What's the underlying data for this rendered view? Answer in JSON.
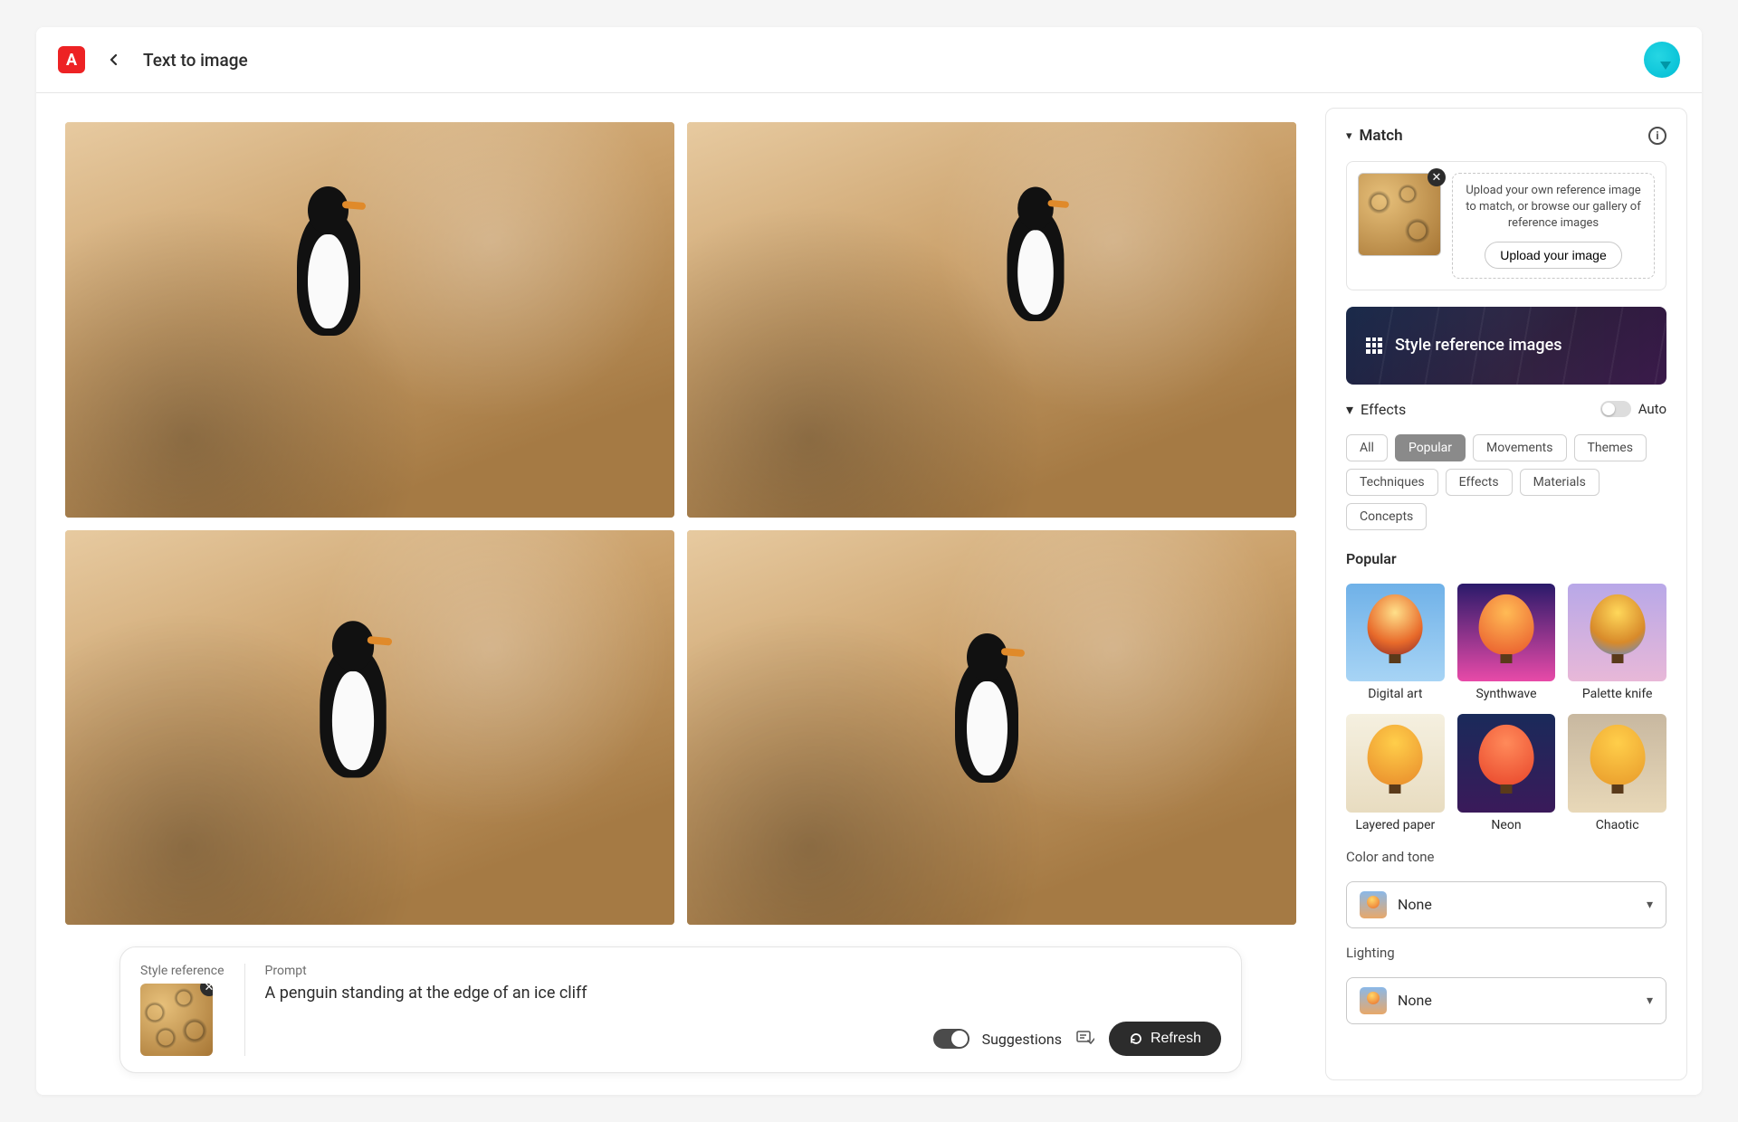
{
  "header": {
    "title": "Text to image"
  },
  "prompt_bar": {
    "style_ref_label": "Style reference",
    "prompt_label": "Prompt",
    "prompt_text": "A penguin standing at the edge of an ice cliff",
    "suggestions_label": "Suggestions",
    "suggestions_on": true,
    "refresh_label": "Refresh"
  },
  "panel": {
    "match": {
      "label": "Match",
      "description": "Upload your own reference image to match, or browse our gallery of reference images",
      "upload_label": "Upload your image",
      "gallery_label": "Style reference images"
    },
    "effects": {
      "label": "Effects",
      "auto_label": "Auto",
      "auto_on": false,
      "categories": [
        "All",
        "Popular",
        "Movements",
        "Themes",
        "Techniques",
        "Effects",
        "Materials",
        "Concepts"
      ],
      "active_category": "Popular",
      "section_title": "Popular",
      "items": [
        "Digital art",
        "Synthwave",
        "Palette knife",
        "Layered paper",
        "Neon",
        "Chaotic"
      ]
    },
    "color_tone": {
      "label": "Color and tone",
      "value": "None"
    },
    "lighting": {
      "label": "Lighting",
      "value": "None"
    }
  }
}
